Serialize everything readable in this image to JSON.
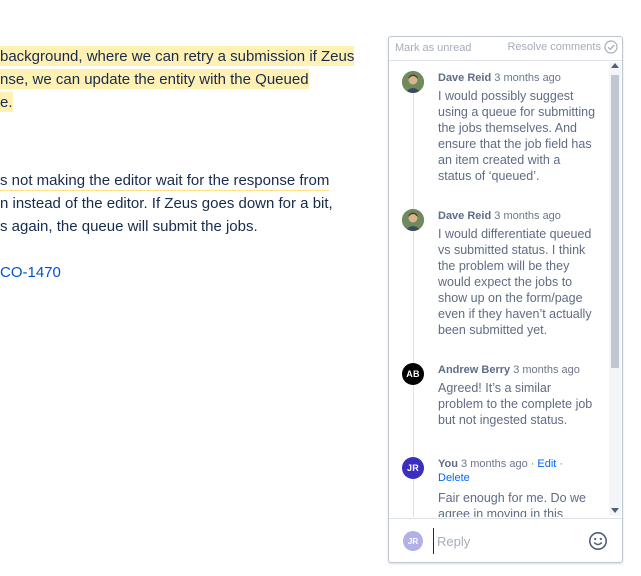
{
  "document": {
    "lines": [
      "background, where we can retry a submission if Zeus",
      "nse, we can update the entity with the Queued",
      "e.",
      "s not making the editor wait for the response from",
      "n instead of the editor. If Zeus goes down for a bit,",
      "s again, the queue will submit the jobs."
    ],
    "link_text": "CO-1470"
  },
  "comments_panel": {
    "mark_unread": "Mark as unread",
    "resolve": "Resolve comments",
    "comments": [
      {
        "author": "Dave Reid",
        "time": "3 months ago",
        "avatar": "photo",
        "body": "I would possibly suggest using a queue for submitting the jobs themselves. And ensure that the job field has an item created with a status of ‘queued’."
      },
      {
        "author": "Dave Reid",
        "time": "3 months ago",
        "avatar": "photo",
        "body": "I would differentiate queued vs submitted status. I think the problem will be they would expect the jobs to show up on the form/page even if they haven’t actually been submitted yet."
      },
      {
        "author": "Andrew Berry",
        "time": "3 months ago",
        "avatar": "AB",
        "body": "Agreed! It’s a similar problem to the complete job but not ingested status."
      },
      {
        "author": "You",
        "time": "3 months ago",
        "avatar": "JR",
        "edit": "Edit",
        "delete": "Delete",
        "body": "Fair enough for me. Do we agree in moving in this direction then? The"
      }
    ],
    "reply": {
      "avatar": "JR",
      "placeholder": "Reply"
    }
  },
  "colors": {
    "highlight": "#fff0b3",
    "link": "#0052cc",
    "avatar_jr": "#3a2fbf"
  }
}
